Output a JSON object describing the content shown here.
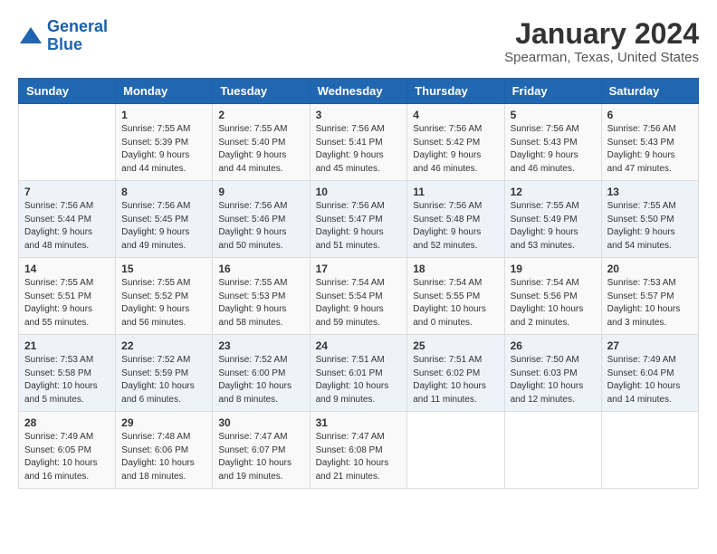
{
  "logo": {
    "name_line1": "General",
    "name_line2": "Blue"
  },
  "header": {
    "month": "January 2024",
    "location": "Spearman, Texas, United States"
  },
  "days_of_week": [
    "Sunday",
    "Monday",
    "Tuesday",
    "Wednesday",
    "Thursday",
    "Friday",
    "Saturday"
  ],
  "weeks": [
    [
      {
        "num": "",
        "info": ""
      },
      {
        "num": "1",
        "info": "Sunrise: 7:55 AM\nSunset: 5:39 PM\nDaylight: 9 hours\nand 44 minutes."
      },
      {
        "num": "2",
        "info": "Sunrise: 7:55 AM\nSunset: 5:40 PM\nDaylight: 9 hours\nand 44 minutes."
      },
      {
        "num": "3",
        "info": "Sunrise: 7:56 AM\nSunset: 5:41 PM\nDaylight: 9 hours\nand 45 minutes."
      },
      {
        "num": "4",
        "info": "Sunrise: 7:56 AM\nSunset: 5:42 PM\nDaylight: 9 hours\nand 46 minutes."
      },
      {
        "num": "5",
        "info": "Sunrise: 7:56 AM\nSunset: 5:43 PM\nDaylight: 9 hours\nand 46 minutes."
      },
      {
        "num": "6",
        "info": "Sunrise: 7:56 AM\nSunset: 5:43 PM\nDaylight: 9 hours\nand 47 minutes."
      }
    ],
    [
      {
        "num": "7",
        "info": "Sunrise: 7:56 AM\nSunset: 5:44 PM\nDaylight: 9 hours\nand 48 minutes."
      },
      {
        "num": "8",
        "info": "Sunrise: 7:56 AM\nSunset: 5:45 PM\nDaylight: 9 hours\nand 49 minutes."
      },
      {
        "num": "9",
        "info": "Sunrise: 7:56 AM\nSunset: 5:46 PM\nDaylight: 9 hours\nand 50 minutes."
      },
      {
        "num": "10",
        "info": "Sunrise: 7:56 AM\nSunset: 5:47 PM\nDaylight: 9 hours\nand 51 minutes."
      },
      {
        "num": "11",
        "info": "Sunrise: 7:56 AM\nSunset: 5:48 PM\nDaylight: 9 hours\nand 52 minutes."
      },
      {
        "num": "12",
        "info": "Sunrise: 7:55 AM\nSunset: 5:49 PM\nDaylight: 9 hours\nand 53 minutes."
      },
      {
        "num": "13",
        "info": "Sunrise: 7:55 AM\nSunset: 5:50 PM\nDaylight: 9 hours\nand 54 minutes."
      }
    ],
    [
      {
        "num": "14",
        "info": "Sunrise: 7:55 AM\nSunset: 5:51 PM\nDaylight: 9 hours\nand 55 minutes."
      },
      {
        "num": "15",
        "info": "Sunrise: 7:55 AM\nSunset: 5:52 PM\nDaylight: 9 hours\nand 56 minutes."
      },
      {
        "num": "16",
        "info": "Sunrise: 7:55 AM\nSunset: 5:53 PM\nDaylight: 9 hours\nand 58 minutes."
      },
      {
        "num": "17",
        "info": "Sunrise: 7:54 AM\nSunset: 5:54 PM\nDaylight: 9 hours\nand 59 minutes."
      },
      {
        "num": "18",
        "info": "Sunrise: 7:54 AM\nSunset: 5:55 PM\nDaylight: 10 hours\nand 0 minutes."
      },
      {
        "num": "19",
        "info": "Sunrise: 7:54 AM\nSunset: 5:56 PM\nDaylight: 10 hours\nand 2 minutes."
      },
      {
        "num": "20",
        "info": "Sunrise: 7:53 AM\nSunset: 5:57 PM\nDaylight: 10 hours\nand 3 minutes."
      }
    ],
    [
      {
        "num": "21",
        "info": "Sunrise: 7:53 AM\nSunset: 5:58 PM\nDaylight: 10 hours\nand 5 minutes."
      },
      {
        "num": "22",
        "info": "Sunrise: 7:52 AM\nSunset: 5:59 PM\nDaylight: 10 hours\nand 6 minutes."
      },
      {
        "num": "23",
        "info": "Sunrise: 7:52 AM\nSunset: 6:00 PM\nDaylight: 10 hours\nand 8 minutes."
      },
      {
        "num": "24",
        "info": "Sunrise: 7:51 AM\nSunset: 6:01 PM\nDaylight: 10 hours\nand 9 minutes."
      },
      {
        "num": "25",
        "info": "Sunrise: 7:51 AM\nSunset: 6:02 PM\nDaylight: 10 hours\nand 11 minutes."
      },
      {
        "num": "26",
        "info": "Sunrise: 7:50 AM\nSunset: 6:03 PM\nDaylight: 10 hours\nand 12 minutes."
      },
      {
        "num": "27",
        "info": "Sunrise: 7:49 AM\nSunset: 6:04 PM\nDaylight: 10 hours\nand 14 minutes."
      }
    ],
    [
      {
        "num": "28",
        "info": "Sunrise: 7:49 AM\nSunset: 6:05 PM\nDaylight: 10 hours\nand 16 minutes."
      },
      {
        "num": "29",
        "info": "Sunrise: 7:48 AM\nSunset: 6:06 PM\nDaylight: 10 hours\nand 18 minutes."
      },
      {
        "num": "30",
        "info": "Sunrise: 7:47 AM\nSunset: 6:07 PM\nDaylight: 10 hours\nand 19 minutes."
      },
      {
        "num": "31",
        "info": "Sunrise: 7:47 AM\nSunset: 6:08 PM\nDaylight: 10 hours\nand 21 minutes."
      },
      {
        "num": "",
        "info": ""
      },
      {
        "num": "",
        "info": ""
      },
      {
        "num": "",
        "info": ""
      }
    ]
  ]
}
